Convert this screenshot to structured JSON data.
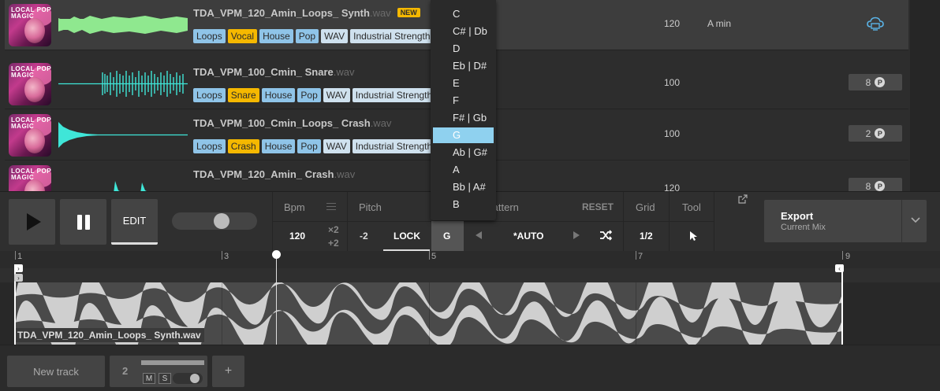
{
  "browser": {
    "rows": [
      {
        "name": "TDA_VPM_120_Amin_Loops_ Synth",
        "ext": ".wav",
        "badge": "NEW",
        "bpm": "120",
        "key": "A min",
        "cover_text": "LOCAL POP MAGIC",
        "tags": [
          "Loops",
          "Vocal",
          "House",
          "Pop",
          "WAV",
          "Industrial Strength"
        ],
        "action": "cloud-icon"
      },
      {
        "name": "TDA_VPM_100_Cmin_ Snare",
        "ext": ".wav",
        "bpm": "100",
        "key": "",
        "cover_text": "LOCAL POP MAGIC",
        "tags": [
          "Loops",
          "Snare",
          "House",
          "Pop",
          "WAV",
          "Industrial Strength"
        ],
        "credits": "8",
        "credit_badge": "P"
      },
      {
        "name": "TDA_VPM_100_Cmin_Loops_ Crash",
        "ext": ".wav",
        "bpm": "100",
        "key": "",
        "cover_text": "LOCAL POP MAGIC",
        "tags": [
          "Loops",
          "Crash",
          "House",
          "Pop",
          "WAV",
          "Industrial Strength"
        ],
        "credits": "2",
        "credit_badge": "P"
      },
      {
        "name": "TDA_VPM_120_Amin_ Crash",
        "ext": ".wav",
        "bpm": "120",
        "key": "",
        "cover_text": "LOCAL POP MAGIC",
        "tags": [],
        "credits": "8",
        "credit_badge": "P"
      }
    ]
  },
  "toolbar": {
    "edit_label": "EDIT",
    "volume_level": 0.6,
    "bpm_label": "Bpm",
    "bpm_value": "120",
    "bpm_mult": "×2",
    "bpm_add": "+2",
    "pitch_label": "Pitch",
    "pitch_value": "-2",
    "lock_label": "LOCK",
    "key_value": "G",
    "pattern_label": "Pattern",
    "reset_label": "RESET",
    "pattern_value": "*AUTO",
    "grid_label": "Grid",
    "grid_value": "1/2",
    "tool_label": "Tool",
    "export_title": "Export",
    "export_sub": "Current Mix"
  },
  "timeline": {
    "bars": [
      "1",
      "3",
      "5",
      "7",
      "9"
    ],
    "clip_name": "TDA_VPM_120_Amin_Loops_ Synth.wav"
  },
  "tracks": {
    "new_track_label": "New track",
    "track_number": "2",
    "mute_label": "M",
    "solo_label": "S",
    "add_label": "+"
  },
  "key_dropdown": {
    "options": [
      "C",
      "C# | Db",
      "D",
      "Eb | D#",
      "E",
      "F",
      "F# | Gb",
      "G",
      "Ab | G#",
      "A",
      "Bb | A#",
      "B"
    ],
    "selected": "G"
  },
  "colors": {
    "tag_blue": "#8fc4e8",
    "tag_yellow": "#f5b800",
    "tag_light": "#cfe1ee",
    "wave_green": "#8fe88f",
    "wave_cyan": "#3fe6d8",
    "dropdown_selected": "#8fd1ef"
  }
}
